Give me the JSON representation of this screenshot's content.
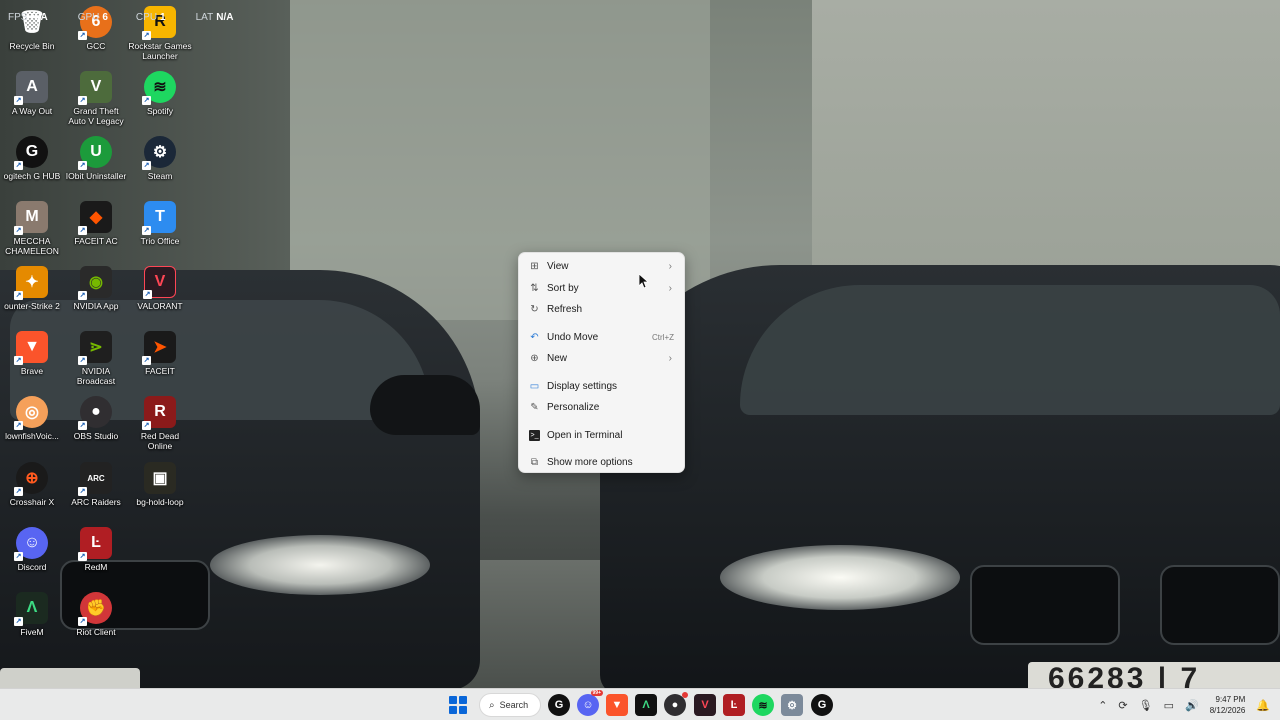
{
  "stats": {
    "fps_label": "FPS",
    "fps_value": "N/A",
    "gpu_label": "GPU",
    "gpu_value": "6",
    "cpu_label": "CPU",
    "cpu_value": "1",
    "lat_label": "LAT",
    "lat_value": "N/A"
  },
  "desktop_icons": [
    {
      "label": "Recycle Bin"
    },
    {
      "label": "GCC"
    },
    {
      "label": "Rockstar Games Launcher"
    },
    {
      "label": "A Way Out"
    },
    {
      "label": "Grand Theft Auto V Legacy"
    },
    {
      "label": "Spotify"
    },
    {
      "label": "ogitech G HUB"
    },
    {
      "label": "IObit Uninstaller"
    },
    {
      "label": "Steam"
    },
    {
      "label": "MECCHA CHAMELEON"
    },
    {
      "label": "FACEIT AC"
    },
    {
      "label": "Trio Office"
    },
    {
      "label": "ounter-Strike 2"
    },
    {
      "label": "NVIDIA App"
    },
    {
      "label": "VALORANT"
    },
    {
      "label": "Brave"
    },
    {
      "label": "NVIDIA Broadcast"
    },
    {
      "label": "FACEIT"
    },
    {
      "label": "lownfishVoic..."
    },
    {
      "label": "OBS Studio"
    },
    {
      "label": "Red Dead Online"
    },
    {
      "label": "Crosshair X"
    },
    {
      "label": "ARC Raiders"
    },
    {
      "label": "bg-hold-loop"
    },
    {
      "label": "Discord"
    },
    {
      "label": "RedM"
    },
    {
      "label": "FiveM"
    },
    {
      "label": "Riot Client"
    }
  ],
  "context_menu": {
    "view": "View",
    "sort_by": "Sort by",
    "refresh": "Refresh",
    "undo_move": "Undo Move",
    "undo_shortcut": "Ctrl+Z",
    "new": "New",
    "display_settings": "Display settings",
    "personalize": "Personalize",
    "open_terminal": "Open in Terminal",
    "show_more": "Show more options"
  },
  "taskbar": {
    "search_label": "Search",
    "time": "9:47 PM",
    "date": "8/12/2026",
    "discord_badge": "99+"
  },
  "wallpaper": {
    "plate_text": "66283 | 7"
  },
  "colors": {
    "accent": "#0a66d8",
    "menu_bg": "#f5f5f5",
    "taskbar_bg": "#e9eaea"
  }
}
